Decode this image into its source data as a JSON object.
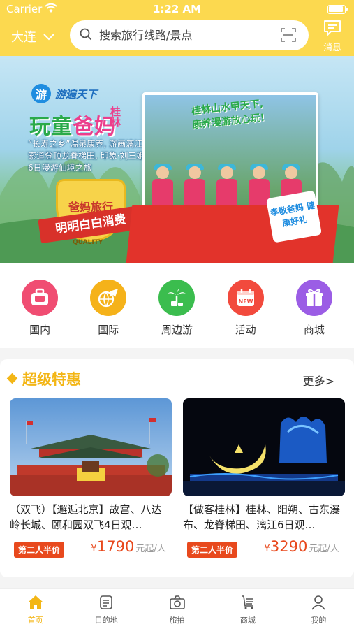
{
  "status_bar": {
    "carrier": "Carrier",
    "time": "1:22 AM"
  },
  "header": {
    "city": "大连",
    "search_placeholder": "搜索旅行线路/景点",
    "message_label": "消息",
    "accent_color": "#fcd94f"
  },
  "banner": {
    "brand_logo": "游",
    "brand_name": "游遍天下",
    "title_part1": "玩童",
    "title_part2": "爸妈",
    "title_side": "桂林",
    "description": "“长寿之乡”温泉康养, 游画漓江,索道登顶龙脊梯田, 印象·刘三姐 6日漫游仙境之旅",
    "badge_text": "爸妈旅行",
    "ribbon_text": "明明白白消费",
    "quality_text": "QUALITY",
    "caption_line1": "桂林山水甲天下,",
    "caption_line2": "康养漫游放心玩!",
    "note_text": "孝敬爸妈 健康好礼",
    "slide_count": 3,
    "active_slide": 1
  },
  "categories": [
    {
      "label": "国内",
      "icon": "suitcase-icon",
      "color": "#f04d72"
    },
    {
      "label": "国际",
      "icon": "airplane-globe-icon",
      "color": "#f5b21a"
    },
    {
      "label": "周边游",
      "icon": "palm-tree-icon",
      "color": "#3bbd4e"
    },
    {
      "label": "活动",
      "icon": "calendar-new-icon",
      "color": "#f24a3d"
    },
    {
      "label": "商城",
      "icon": "gift-icon",
      "color": "#9b5de5"
    }
  ],
  "deals": {
    "title": "超级特惠",
    "more_label": "更多>",
    "items": [
      {
        "name": "（双飞）【邂逅北京】故宫、八达岭长城、颐和园双飞4日观…",
        "promo": "第二人半价",
        "currency": "¥",
        "price": "1790",
        "unit": "元起/人",
        "image": "tiananmen-photo"
      },
      {
        "name": "【做客桂林】桂林、阳朔、古东瀑布、龙脊梯田、漓江6日观…",
        "promo": "第二人半价",
        "currency": "¥",
        "price": "3290",
        "unit": "元起/人",
        "image": "guilin-night-moon-photo"
      }
    ]
  },
  "tabbar": [
    {
      "label": "首页",
      "icon": "home-icon",
      "active": true
    },
    {
      "label": "目的地",
      "icon": "destination-icon",
      "active": false
    },
    {
      "label": "旅拍",
      "icon": "camera-icon",
      "active": false
    },
    {
      "label": "商城",
      "icon": "shop-icon",
      "active": false
    },
    {
      "label": "我的",
      "icon": "user-icon",
      "active": false
    }
  ]
}
